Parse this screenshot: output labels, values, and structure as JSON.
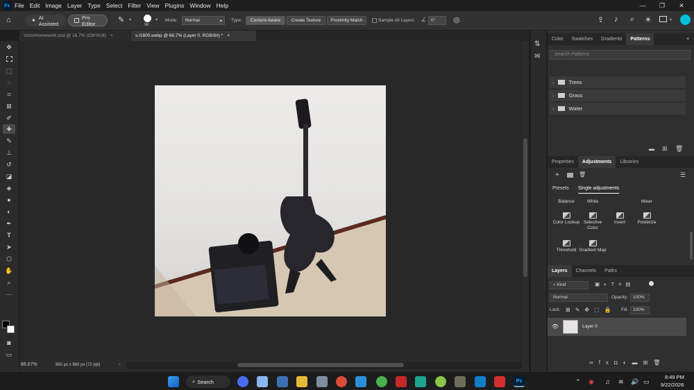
{
  "app": {
    "logo": "Ps"
  },
  "menu": [
    "File",
    "Edit",
    "Image",
    "Layer",
    "Type",
    "Select",
    "Filter",
    "View",
    "Plugins",
    "Window",
    "Help"
  ],
  "window_controls": {
    "minimize": "—",
    "restore": "❐",
    "close": "✕"
  },
  "options": {
    "ai_assisted": "AI Assisted",
    "pro_editor": "Pro Editor",
    "brush_size": "90",
    "mode_label": "Mode:",
    "mode_value": "Normal",
    "type_label": "Type:",
    "type_buttons": [
      "Content-Aware",
      "Create Texture",
      "Proximity Match"
    ],
    "sample_all_layers": "Sample All Layers",
    "angle": "0°"
  },
  "tabs": [
    {
      "title": "VictorHomework.psd @ 16.7% (CMYK/8)",
      "close": "×",
      "active": false
    },
    {
      "title": "s-l1600.webp @ 66.7% (Layer 0, RGB/8#) *",
      "close": "×",
      "active": true
    }
  ],
  "status": {
    "zoom": "66.67%",
    "doc_info": "960 px x 960 px (72 ppi)"
  },
  "panel_top": {
    "tabs": [
      "Color",
      "Swatches",
      "Gradients",
      "Patterns"
    ],
    "active": "Patterns",
    "search_placeholder": "Search Patterns",
    "folders": [
      "Trees",
      "Grass",
      "Water"
    ]
  },
  "panel_mid": {
    "tabs": [
      "Properties",
      "Adjustments",
      "Libraries"
    ],
    "active": "Adjustments",
    "subtabs": [
      "Presets",
      "Single adjustments"
    ],
    "sub_active": "Single adjustments",
    "row1": [
      "Balance",
      "White",
      "Mixer"
    ],
    "grid1": [
      "Color Lookup",
      "Selective Color",
      "Invert",
      "Posterize"
    ],
    "grid2": [
      "Threshold",
      "Gradient Map"
    ]
  },
  "panel_layers": {
    "tabs": [
      "Layers",
      "Channels",
      "Paths"
    ],
    "active": "Layers",
    "kind": "Kind",
    "blend": "Normal",
    "opacity_label": "Opacity:",
    "opacity": "100%",
    "lock_label": "Lock:",
    "fill_label": "Fill:",
    "fill": "100%",
    "layers": [
      {
        "name": "Layer 0",
        "visible": true
      }
    ]
  },
  "taskbar": {
    "search": "Search",
    "time": "8:49 PM",
    "date": "9/22/2026"
  }
}
